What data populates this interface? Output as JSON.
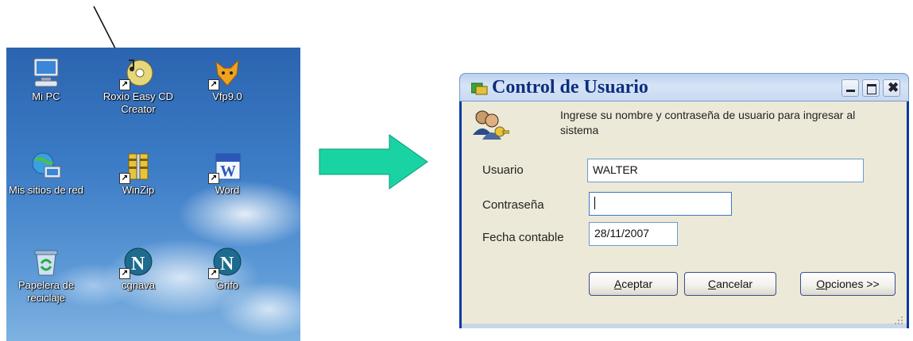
{
  "desktop": {
    "icons": [
      {
        "label": "Mi PC",
        "icon": "my-computer-icon"
      },
      {
        "label": "Roxio Easy CD Creator",
        "icon": "cd-creator-icon"
      },
      {
        "label": "Vfp9.0",
        "icon": "foxpro-icon"
      },
      {
        "label": "Mis sitios de red",
        "icon": "network-places-icon"
      },
      {
        "label": "WinZip",
        "icon": "winzip-icon"
      },
      {
        "label": "Word",
        "icon": "word-icon"
      },
      {
        "label": "Papelera de reciclaje",
        "icon": "recycle-bin-icon"
      },
      {
        "label": "cgnava",
        "icon": "netscape-icon"
      },
      {
        "label": "Grifo",
        "icon": "netscape-icon"
      }
    ]
  },
  "dialog": {
    "title": "Control de Usuario",
    "instructions": "Ingrese su nombre y contraseña de usuario para ingresar al sistema",
    "fields": {
      "usuario": {
        "label": "Usuario",
        "value": "WALTER"
      },
      "contrasena": {
        "label": "Contraseña",
        "value": ""
      },
      "fecha": {
        "label": "Fecha contable",
        "value": "28/11/2007"
      }
    },
    "buttons": {
      "aceptar": {
        "mnemonic": "A",
        "rest": "ceptar"
      },
      "cancelar": {
        "mnemonic": "C",
        "rest": "ancelar"
      },
      "opciones": {
        "mnemonic": "O",
        "rest": "pciones >>"
      }
    }
  },
  "colors": {
    "arrow": "#19d3a2",
    "titlebar_text": "#0c2f7e"
  }
}
